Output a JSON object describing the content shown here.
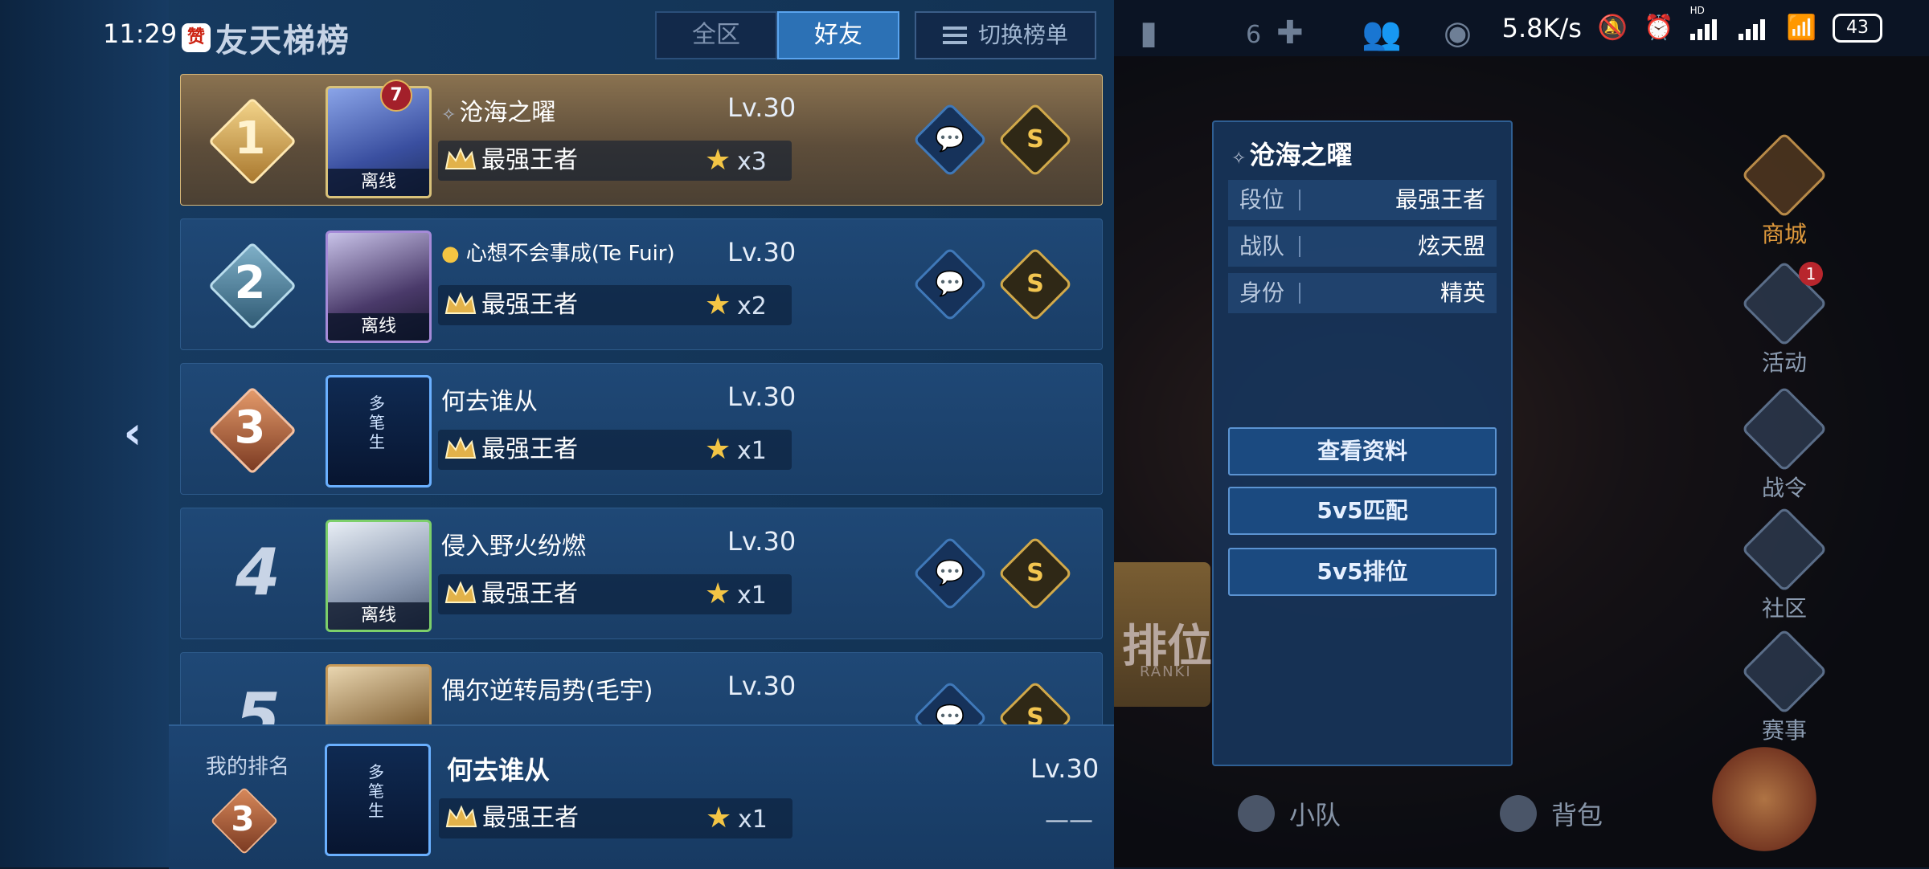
{
  "status_bar": {
    "time": "11:29",
    "net_speed": "5.8K/s",
    "hd_label": "HD",
    "battery": "43"
  },
  "header": {
    "title_icon_text": "赞",
    "title": "友天梯榜",
    "tabs": [
      {
        "label": "全区",
        "active": false
      },
      {
        "label": "好友",
        "active": true
      }
    ],
    "switch_label": "切换榜单"
  },
  "back_icon": "chevron-left-icon",
  "list": [
    {
      "rank": "1",
      "name": "沧海之曜",
      "level": "Lv.30",
      "tier": "最强王者",
      "stars": "x3",
      "status": "离线",
      "vip": "7",
      "has_actions": true,
      "highlight": true
    },
    {
      "rank": "2",
      "name": "心想不会事成(Te  Fuir)",
      "level": "Lv.30",
      "tier": "最强王者",
      "stars": "x2",
      "status": "离线",
      "has_actions": true
    },
    {
      "rank": "3",
      "name": "何去谁从",
      "level": "Lv.30",
      "tier": "最强王者",
      "stars": "x1",
      "status": "",
      "has_actions": false
    },
    {
      "rank": "4",
      "name": "侵入野火纷燃",
      "level": "Lv.30",
      "tier": "最强王者",
      "stars": "x1",
      "status": "离线",
      "has_actions": true
    },
    {
      "rank": "5",
      "name": "偶尔逆转局势(毛宇)",
      "level": "Lv.30",
      "tier": "",
      "stars": "",
      "status": "",
      "has_actions": true
    }
  ],
  "my_rank": {
    "label": "我的排名",
    "rank": "3",
    "name": "何去谁从",
    "level": "Lv.30",
    "tier": "最强王者",
    "stars": "x1",
    "dash": "——"
  },
  "detail": {
    "name": "沧海之曜",
    "rows": [
      {
        "key": "段位",
        "value": "最强王者"
      },
      {
        "key": "战队",
        "value": "炫天盟"
      },
      {
        "key": "身份",
        "value": "精英"
      }
    ],
    "buttons": [
      "查看资料",
      "5v5匹配",
      "5v5排位"
    ]
  },
  "right_side": {
    "top_count": "6",
    "side_items": [
      {
        "label": "商城",
        "hot": true
      },
      {
        "label": "活动",
        "badge": "1"
      },
      {
        "label": "战令"
      },
      {
        "label": "社区"
      },
      {
        "label": "赛事"
      }
    ],
    "bottom_nav": [
      "小队",
      "背包"
    ],
    "ranking_banner": "排位",
    "ranking_sub": "RANKI"
  },
  "colors": {
    "accent": "#2c71b5",
    "gold": "#d8b97a",
    "star": "#f3c545",
    "rank3": "#c0683e"
  }
}
